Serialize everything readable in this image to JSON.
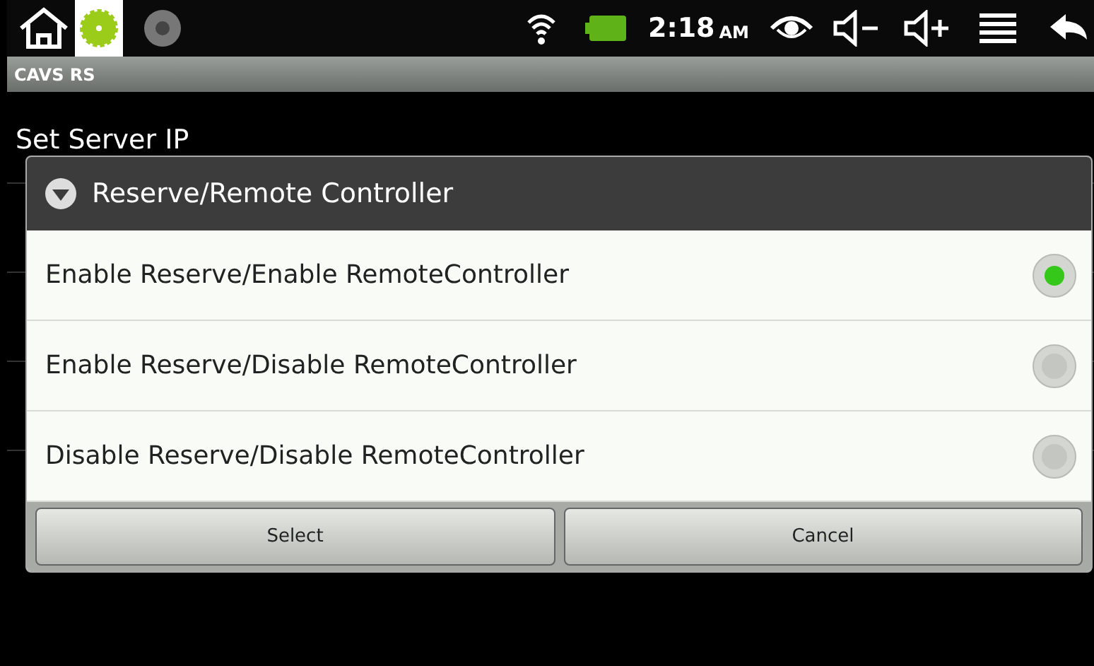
{
  "status_bar": {
    "time": "2:18",
    "am_pm": "AM"
  },
  "app_title": "CAVS RS",
  "list_items": [
    "Set Server IP"
  ],
  "dialog": {
    "title": "Reserve/Remote Controller",
    "options": [
      {
        "label": "Enable Reserve/Enable RemoteController",
        "selected": true
      },
      {
        "label": "Enable Reserve/Disable RemoteController",
        "selected": false
      },
      {
        "label": "Disable Reserve/Disable RemoteController",
        "selected": false
      }
    ],
    "buttons": [
      "Select",
      "Cancel"
    ]
  }
}
